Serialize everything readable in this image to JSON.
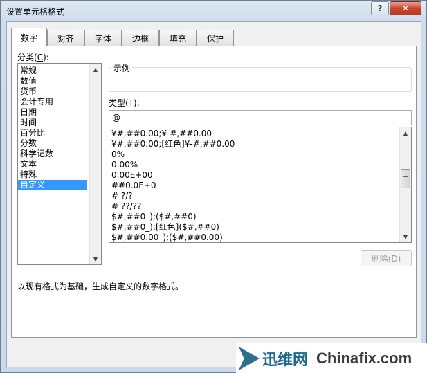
{
  "window": {
    "title": "设置单元格格式",
    "help_glyph": "?",
    "close_glyph": "✕"
  },
  "tabs": [
    {
      "label": "数字",
      "active": true
    },
    {
      "label": "对齐"
    },
    {
      "label": "字体"
    },
    {
      "label": "边框"
    },
    {
      "label": "填充"
    },
    {
      "label": "保护"
    }
  ],
  "category": {
    "label_prefix": "分类(",
    "label_key": "C",
    "label_suffix": "):",
    "items": [
      "常规",
      "数值",
      "货币",
      "会计专用",
      "日期",
      "时间",
      "百分比",
      "分数",
      "科学记数",
      "文本",
      "特殊",
      "自定义"
    ],
    "selected": "自定义"
  },
  "sample": {
    "label": "示例"
  },
  "type": {
    "label_prefix": "类型(",
    "label_key": "T",
    "label_suffix": "):",
    "value": "@",
    "formats": [
      "¥#,##0.00;¥-#,##0.00",
      "¥#,##0.00;[红色]¥-#,##0.00",
      "0%",
      "0.00%",
      "0.00E+00",
      "##0.0E+0",
      "# ?/?",
      "# ??/??",
      "$#,##0_);($#,##0)",
      "$#,##0_);[红色]($#,##0)",
      "$#,##0.00_);($#,##0.00)"
    ]
  },
  "delete_button": {
    "label": "删除(D)"
  },
  "description": "以现有格式为基础，生成自定义的数字格式。",
  "watermark": {
    "cn": "迅维网",
    "en": "Chinafix.com"
  },
  "colors": {
    "selection": "#3399ff",
    "close_button": "#c8442c",
    "watermark_blue": "#1c6a8e"
  }
}
